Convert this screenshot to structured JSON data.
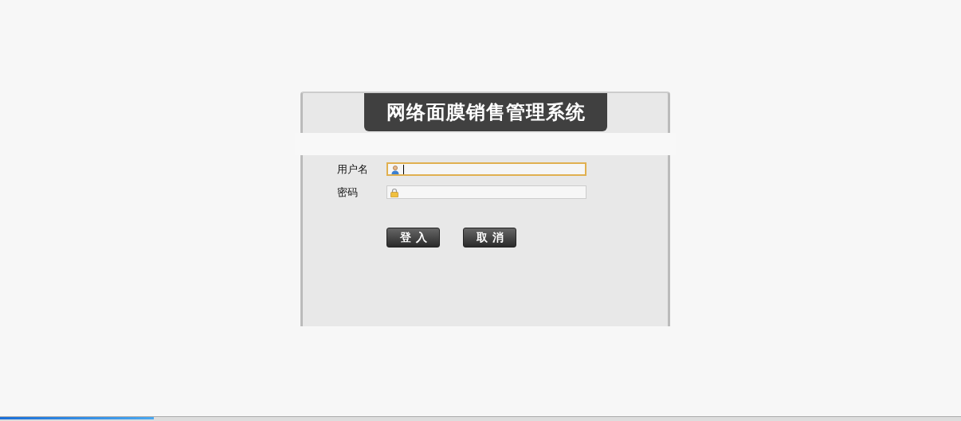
{
  "title": "网络面膜销售管理系统",
  "fields": [
    {
      "label": "用户名",
      "kind": "user",
      "focused": true
    },
    {
      "label": "密码",
      "kind": "password",
      "focused": false
    }
  ],
  "buttons": [
    "登入",
    "取消"
  ],
  "progress": {
    "level": 0.16
  }
}
